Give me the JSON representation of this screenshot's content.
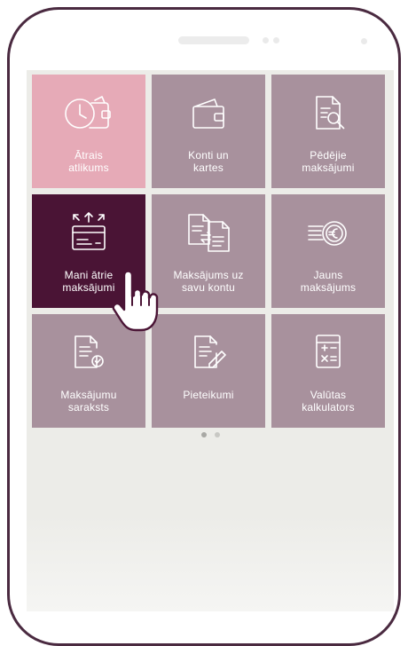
{
  "tiles": [
    {
      "id": "atrais-atlikums",
      "label": "Ātrais\natlikums",
      "icon": "clock-wallet-icon",
      "style": "pink"
    },
    {
      "id": "konti-un-kartes",
      "label": "Konti un\nkartes",
      "icon": "wallet-icon",
      "style": "normal"
    },
    {
      "id": "pedejie-maksajumi",
      "label": "Pēdējie\nmaksājumi",
      "icon": "document-search-icon",
      "style": "normal"
    },
    {
      "id": "mani-atrie-maksajumi",
      "label": "Mani ātrie\nmaksājumi",
      "icon": "card-arrows-icon",
      "style": "dark"
    },
    {
      "id": "maksajums-uz-savu-kontu",
      "label": "Maksājums uz\nsavu kontu",
      "icon": "documents-transfer-icon",
      "style": "normal"
    },
    {
      "id": "jauns-maksajums",
      "label": "Jauns\nmaksājums",
      "icon": "euro-coin-icon",
      "style": "normal"
    },
    {
      "id": "maksajumu-saraksts",
      "label": "Maksājumu\nsaraksts",
      "icon": "document-check-icon",
      "style": "normal"
    },
    {
      "id": "pieteikumi",
      "label": "Pieteikumi",
      "icon": "document-edit-icon",
      "style": "normal"
    },
    {
      "id": "valutas-kalkulators",
      "label": "Valūtas\nkalkulators",
      "icon": "calculator-icon",
      "style": "normal"
    }
  ],
  "pager": {
    "pages": 2,
    "active": 0
  },
  "colors": {
    "tile": "#a8919d",
    "tile_pink": "#e6aab7",
    "tile_dark": "#4a1435",
    "screen_bg": "#ecece8",
    "phone_frame": "#4a2a40"
  }
}
